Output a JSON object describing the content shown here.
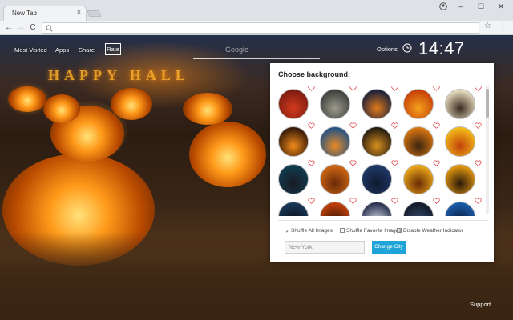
{
  "browser": {
    "tab_title": "New Tab",
    "tab_close": "×",
    "window_min": "–",
    "window_max": "☐",
    "window_close": "✕",
    "nav_back": "←",
    "nav_forward": "→",
    "nav_reload": "C",
    "bookmark_star": "☆",
    "menu": "⋮",
    "address": ""
  },
  "page": {
    "top_links": [
      "Most Visited",
      "Apps",
      "Share"
    ],
    "rate_label": "Rate",
    "search_placeholder": "Google",
    "options_label": "Options",
    "clock": "14:47",
    "date": "",
    "support_label": "Support",
    "background_marquee": "HAPPY HALL"
  },
  "chooser": {
    "title": "Choose background:",
    "thumbnails": [
      {
        "name": "halloween-sign",
        "colors": [
          "#7b1a10",
          "#d13a1e"
        ]
      },
      {
        "name": "graveyard-letters",
        "colors": [
          "#3a3a3a",
          "#9a9a8a"
        ]
      },
      {
        "name": "dark-pumpkin-night",
        "colors": [
          "#0e1a3c",
          "#e07a1a"
        ]
      },
      {
        "name": "witch-sunset",
        "colors": [
          "#c43a05",
          "#f5a21e"
        ]
      },
      {
        "name": "witches-moon",
        "colors": [
          "#f1e6c8",
          "#3a2c22"
        ]
      },
      {
        "name": "carved-pumpkin",
        "colors": [
          "#2a1206",
          "#f08a1a"
        ]
      },
      {
        "name": "pumpkins-sky",
        "colors": [
          "#184f8a",
          "#e88a24"
        ]
      },
      {
        "name": "happy-halloween-text",
        "colors": [
          "#1a1410",
          "#d9901e"
        ]
      },
      {
        "name": "pumpkins-cemetery",
        "colors": [
          "#e27a10",
          "#3a2410"
        ]
      },
      {
        "name": "sunset-pumpkins",
        "colors": [
          "#f5c21a",
          "#c2420a"
        ]
      },
      {
        "name": "haunted-castle",
        "colors": [
          "#0e3e50",
          "#1a1a24"
        ]
      },
      {
        "name": "pumpkin-patch",
        "colors": [
          "#d46a14",
          "#6a2a08"
        ]
      },
      {
        "name": "blue-night",
        "colors": [
          "#203a6a",
          "#0e1a30"
        ]
      },
      {
        "name": "black-cat",
        "colors": [
          "#f2b01a",
          "#6a2a05"
        ]
      },
      {
        "name": "spooky-cat-moon",
        "colors": [
          "#f0a012",
          "#2a1a08"
        ]
      },
      {
        "name": "foggy-night",
        "colors": [
          "#1a3a5a",
          "#0a0e18"
        ]
      },
      {
        "name": "orange-lights",
        "colors": [
          "#c8420a",
          "#3a1405"
        ]
      },
      {
        "name": "bats-moon",
        "colors": [
          "#202848",
          "#d0d6e0"
        ]
      },
      {
        "name": "night-forest",
        "colors": [
          "#101828",
          "#3a4a6a"
        ]
      },
      {
        "name": "blue-moon",
        "colors": [
          "#1a60b0",
          "#0a1a3a"
        ]
      }
    ],
    "shuffle_all_label": "Shuffle All Images",
    "shuffle_all_checked": true,
    "shuffle_fav_label": "Shuffle Favorite Images",
    "shuffle_fav_checked": false,
    "disable_weather_label": "Disable Weather Indicator",
    "disable_weather_checked": false,
    "city_value": "New York",
    "change_city_label": "Change City"
  },
  "colors": {
    "accent_button": "#1fa4d9",
    "heart": "#e04a4a"
  }
}
